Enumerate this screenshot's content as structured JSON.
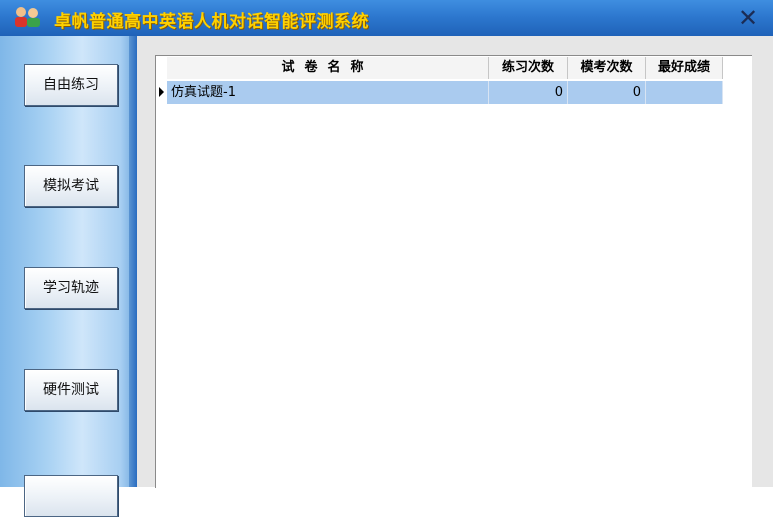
{
  "window": {
    "title": "卓帆普通高中英语人机对话智能评测系统",
    "close_icon": "close-icon",
    "app_icon": "app-logo-icon"
  },
  "sidebar": {
    "items": [
      {
        "label": "自由练习"
      },
      {
        "label": "模拟考试"
      },
      {
        "label": "学习轨迹"
      },
      {
        "label": "硬件测试"
      },
      {
        "label": ""
      }
    ]
  },
  "grid": {
    "columns": [
      "试卷名称",
      "练习次数",
      "模考次数",
      "最好成绩"
    ],
    "rows": [
      {
        "name": "仿真试题-1",
        "practice_count": "0",
        "mock_count": "0",
        "best_score": "",
        "selected": true
      }
    ]
  },
  "colors": {
    "title_text": "#ffd100",
    "titlebar": "#2d78cf",
    "selected_row": "#aacbef",
    "sidebar": "#a9d2f3"
  }
}
